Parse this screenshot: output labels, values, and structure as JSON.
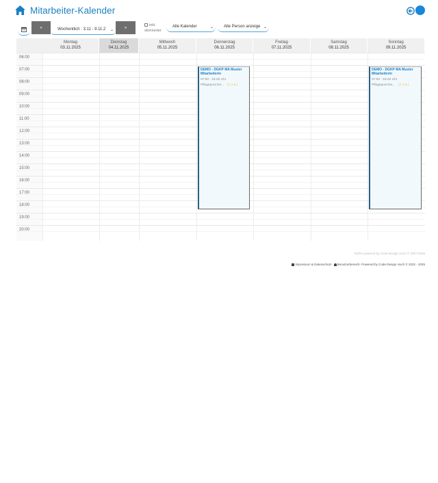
{
  "header": {
    "title": "Mitarbeiter-Kalender"
  },
  "toolbar": {
    "prev_label": "«",
    "next_label": "»",
    "week_select_value": "Wochentlich : 3.11 - 9.11.2",
    "storno_label_line1": "inkl.",
    "storno_label_line2": "stornierter",
    "calendar_select_value": "Alle Kalender",
    "person_select_value": "Alle Person anzeige"
  },
  "days": [
    {
      "name": "Montag",
      "date": "03.11.2025"
    },
    {
      "name": "Dienstag",
      "date": "04.11.2025"
    },
    {
      "name": "Mittwoch",
      "date": "05.11.2025"
    },
    {
      "name": "Donnerstag",
      "date": "06.11.2025"
    },
    {
      "name": "Freitag",
      "date": "07.11.2025"
    },
    {
      "name": "Samstag",
      "date": "08.11.2025"
    },
    {
      "name": "Sonntag",
      "date": "09.11.2025"
    }
  ],
  "active_day_index": 1,
  "hours": [
    "06:00",
    "07:00",
    "08:00",
    "09:00",
    "10:00",
    "11:00",
    "12:00",
    "13:00",
    "14:00",
    "15:00",
    "16:00",
    "17:00",
    "18:00",
    "19:00",
    "20:00"
  ],
  "events": [
    {
      "title": "DEMO - DGKP MA Muster Mitarbeiterin",
      "time": "07:00 - 18:45 Uhr",
      "subtitle": "Pflegepool De...",
      "tag": "(7.1.6.)"
    },
    {
      "title": "DEMO - DGKP MA Muster Mitarbeiterin",
      "time": "07:00 - 18:45 Uhr",
      "subtitle": "Pflegepool De...",
      "tag": "(7.1.6.)"
    }
  ],
  "footer": {
    "line1": "NOPA powered by Code-Design Hoch © 2007-2025",
    "impressum": "Impressum & Datenschutz",
    "separator": " - ",
    "benutzer": "Benutzerbereich",
    "powered": " - Powered by Code-Design Hoch © 2022 - 2025"
  },
  "colors": {
    "accent": "#1a7fc0",
    "event_bg": "#f2f9fd",
    "tag": "#e8c14a"
  }
}
